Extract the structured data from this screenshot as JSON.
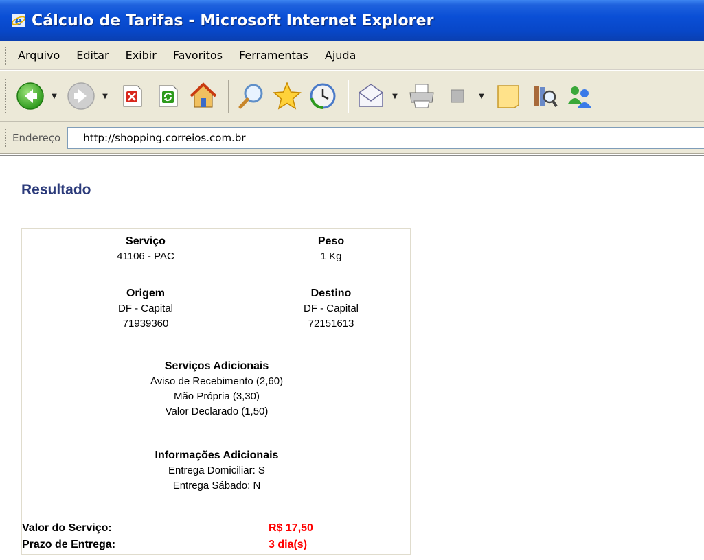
{
  "window": {
    "title": "Cálculo de Tarifas - Microsoft Internet Explorer"
  },
  "menu": {
    "items": [
      "Arquivo",
      "Editar",
      "Exibir",
      "Favoritos",
      "Ferramentas",
      "Ajuda"
    ]
  },
  "toolbar": {
    "buttons": [
      "back-icon",
      "forward-icon",
      "stop-icon",
      "refresh-icon",
      "home-icon",
      "search-icon",
      "favorites-icon",
      "history-icon",
      "mail-icon",
      "print-icon",
      "edit-icon",
      "discuss-icon",
      "research-icon",
      "messenger-icon"
    ]
  },
  "address": {
    "label": "Endereço",
    "url": "http://shopping.correios.com.br"
  },
  "result": {
    "heading": "Resultado",
    "servico_label": "Serviço",
    "servico_value": "41106 - PAC",
    "peso_label": "Peso",
    "peso_value": "1 Kg",
    "origem_label": "Origem",
    "origem_city": "DF - Capital",
    "origem_cep": "71939360",
    "destino_label": "Destino",
    "destino_city": "DF - Capital",
    "destino_cep": "72151613",
    "adicionais_label": "Serviços Adicionais",
    "adicionais": [
      "Aviso de Recebimento (2,60)",
      "Mão Própria (3,30)",
      "Valor Declarado (1,50)"
    ],
    "info_label": "Informações Adicionais",
    "info": [
      "Entrega Domiciliar: S",
      "Entrega Sábado: N"
    ],
    "valor_label": "Valor do Serviço:",
    "valor_value": "R$ 17,50",
    "prazo_label": "Prazo de Entrega:",
    "prazo_value": "3 dia(s)"
  },
  "colors": {
    "titlebar": "#0a4fd6",
    "chrome": "#ece9d8",
    "heading": "#2b3a7a",
    "highlight": "#ff0000"
  }
}
